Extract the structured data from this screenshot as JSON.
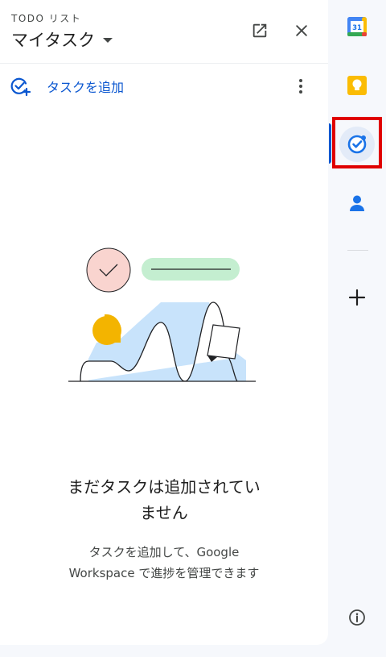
{
  "header": {
    "eyebrow": "TODO リスト",
    "title": "マイタスク"
  },
  "toolbar": {
    "add_task_label": "タスクを追加"
  },
  "empty_state": {
    "title_line1": "まだタスクは追加されてい",
    "title_line2": "ません",
    "subtitle_line1": "タスクを追加して、Google",
    "subtitle_line2": "Workspace で進捗を管理できます"
  },
  "rail": {
    "calendar_day": "31",
    "items": [
      "calendar-icon",
      "keep-icon",
      "tasks-icon",
      "contacts-icon"
    ]
  },
  "colors": {
    "accent": "#0b57d0",
    "highlight": "#e00000"
  }
}
